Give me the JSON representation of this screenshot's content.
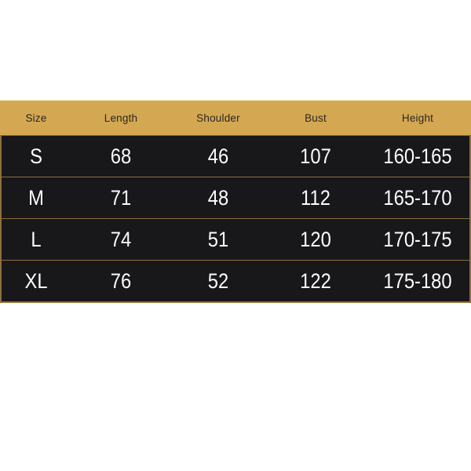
{
  "table": {
    "columns": [
      "Size",
      "Length",
      "Shoulder",
      "Bust",
      "Height"
    ],
    "rows": [
      {
        "size": "S",
        "length": "68",
        "shoulder": "46",
        "bust": "107",
        "height": "160-165"
      },
      {
        "size": "M",
        "length": "71",
        "shoulder": "48",
        "bust": "112",
        "height": "165-170"
      },
      {
        "size": "L",
        "length": "74",
        "shoulder": "51",
        "bust": "120",
        "height": "170-175"
      },
      {
        "size": "XL",
        "length": "76",
        "shoulder": "52",
        "bust": "122",
        "height": "175-180"
      }
    ]
  },
  "colors": {
    "header_background": "#d4a852",
    "header_text": "#2b2620",
    "row_background": "#18171a",
    "row_text": "#fdfdfd",
    "rule": "#8c6f3c",
    "page_background": "#ffffff"
  },
  "chart_data": {
    "type": "table",
    "title": "",
    "categories": [
      "S",
      "M",
      "L",
      "XL"
    ],
    "columns": [
      "Size",
      "Length",
      "Shoulder",
      "Bust",
      "Height"
    ],
    "series": [
      {
        "name": "Length",
        "values": [
          68,
          71,
          74,
          76
        ]
      },
      {
        "name": "Shoulder",
        "values": [
          46,
          48,
          51,
          52
        ]
      },
      {
        "name": "Bust",
        "values": [
          107,
          112,
          120,
          122
        ]
      },
      {
        "name": "Height",
        "values": [
          "160-165",
          "165-170",
          "170-175",
          "175-180"
        ]
      }
    ],
    "xlabel": "Size",
    "ylabel": "",
    "grid": true,
    "legend": "none"
  }
}
